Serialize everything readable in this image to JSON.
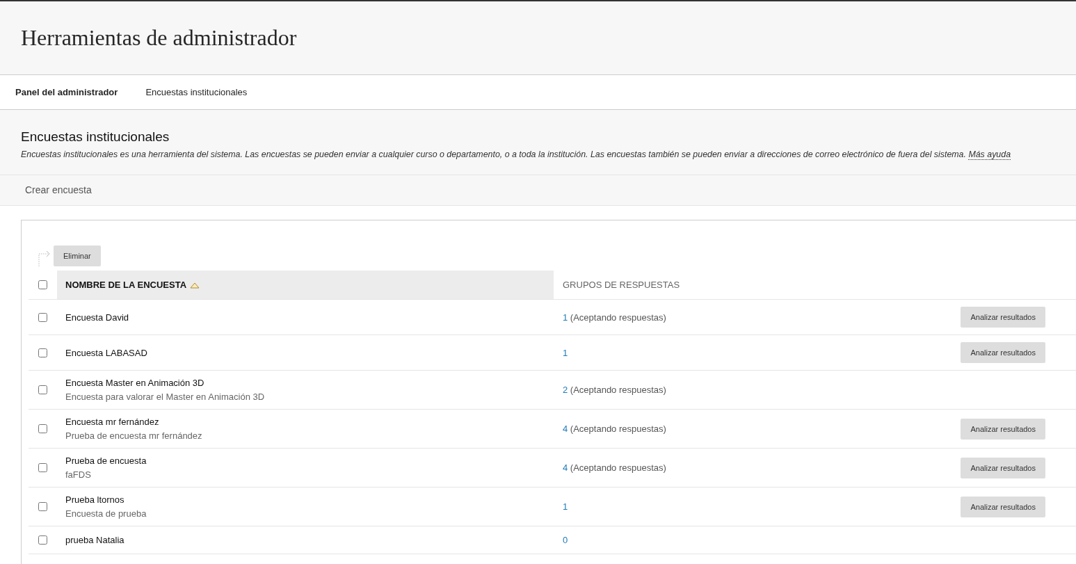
{
  "page_title": "Herramientas de administrador",
  "breadcrumbs": [
    {
      "label": "Panel del administrador",
      "selected": true
    },
    {
      "label": "Encuestas institucionales",
      "selected": false
    }
  ],
  "section": {
    "title": "Encuestas institucionales",
    "description": "Encuestas institucionales es una herramienta del sistema. Las encuestas se pueden enviar a cualquier curso o departamento, o a toda la institución. Las encuestas también se pueden enviar a direcciones de correo electrónico de fuera del sistema.",
    "help_link": "Más ayuda"
  },
  "action_bar": [
    "Crear encuesta"
  ],
  "bulk_action": "Eliminar",
  "table": {
    "select_all_checked": false,
    "columns": [
      {
        "label": "NOMBRE DE LA ENCUESTA",
        "sorted": true
      },
      {
        "label": "GRUPOS DE RESPUESTAS",
        "sorted": false
      }
    ],
    "rows": [
      {
        "name": "Encuesta David",
        "checked": false,
        "groups": "1",
        "status": "(Aceptando respuestas)",
        "action": "Analizar resultados"
      },
      {
        "name": "Encuesta LABASAD",
        "checked": false,
        "groups": "1",
        "action": "Analizar resultados"
      },
      {
        "name": "Encuesta Master en Animación 3D",
        "description": "Encuesta para valorar el Master en Animación 3D",
        "checked": false,
        "groups": "2",
        "status": "(Aceptando respuestas)"
      },
      {
        "name": "Encuesta mr fernández",
        "description": "Prueba de encuesta mr fernández",
        "checked": false,
        "groups": "4",
        "status": "(Aceptando respuestas)",
        "action": "Analizar resultados"
      },
      {
        "name": "Prueba de encuesta",
        "description": "faFDS",
        "checked": false,
        "groups": "4",
        "status": "(Aceptando respuestas)",
        "action": "Analizar resultados"
      },
      {
        "name": "Prueba ltornos",
        "description": "Encuesta de prueba",
        "checked": false,
        "groups": "1",
        "action": "Analizar resultados"
      },
      {
        "name": "prueba Natalia",
        "checked": false,
        "groups": "0"
      }
    ]
  }
}
